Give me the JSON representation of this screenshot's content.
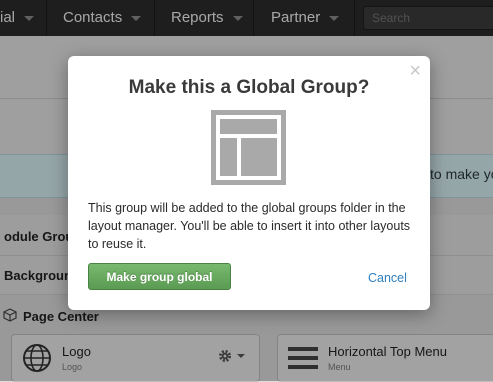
{
  "nav": {
    "items": [
      {
        "label": "ial"
      },
      {
        "label": "Contacts"
      },
      {
        "label": "Reports"
      },
      {
        "label": "Partner"
      }
    ],
    "search_placeholder": "Search"
  },
  "background": {
    "banner_text": "to make yo",
    "rows": {
      "module_group": "odule Group",
      "background": "Backgroun",
      "page_center": "Page Center"
    },
    "cards": {
      "logo": {
        "title": "Logo",
        "subtitle": "Logo"
      },
      "menu": {
        "title": "Horizontal Top Menu",
        "subtitle": "Menu"
      }
    }
  },
  "modal": {
    "title": "Make this a Global Group?",
    "close_glyph": "×",
    "body": "This group will be added to the global groups folder in the layout manager. You'll be able to insert it into other layouts to reuse it.",
    "primary_label": "Make group global",
    "cancel_label": "Cancel"
  },
  "colors": {
    "nav_bg": "#2b2b2b",
    "primary_button": "#66a75d",
    "link": "#2f7fbf",
    "banner_bg": "#d6eef3"
  },
  "icons": [
    "layout-template-icon",
    "globe-icon",
    "gear-icon",
    "hamburger-icon",
    "cube-icon",
    "caret-down-icon"
  ]
}
